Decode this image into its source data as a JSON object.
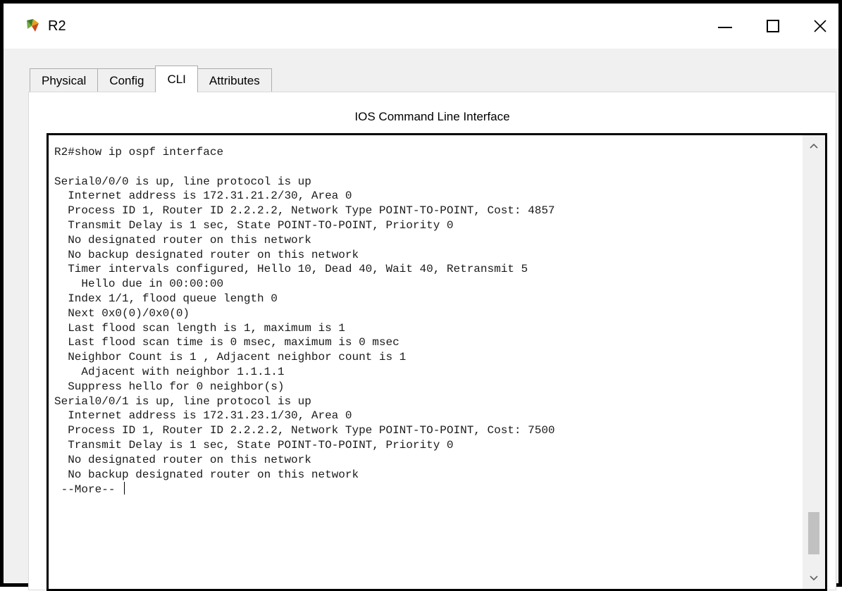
{
  "window": {
    "title": "R2",
    "icon": "router-device-icon"
  },
  "tabs": [
    {
      "label": "Physical",
      "active": false
    },
    {
      "label": "Config",
      "active": false
    },
    {
      "label": "CLI",
      "active": true
    },
    {
      "label": "Attributes",
      "active": false
    }
  ],
  "panel": {
    "title": "IOS Command Line Interface"
  },
  "cli": {
    "lines": [
      "R2#show ip ospf interface",
      "",
      "Serial0/0/0 is up, line protocol is up",
      "  Internet address is 172.31.21.2/30, Area 0",
      "  Process ID 1, Router ID 2.2.2.2, Network Type POINT-TO-POINT, Cost: 4857",
      "  Transmit Delay is 1 sec, State POINT-TO-POINT, Priority 0",
      "  No designated router on this network",
      "  No backup designated router on this network",
      "  Timer intervals configured, Hello 10, Dead 40, Wait 40, Retransmit 5",
      "    Hello due in 00:00:00",
      "  Index 1/1, flood queue length 0",
      "  Next 0x0(0)/0x0(0)",
      "  Last flood scan length is 1, maximum is 1",
      "  Last flood scan time is 0 msec, maximum is 0 msec",
      "  Neighbor Count is 1 , Adjacent neighbor count is 1",
      "    Adjacent with neighbor 1.1.1.1",
      "  Suppress hello for 0 neighbor(s)",
      "Serial0/0/1 is up, line protocol is up",
      "  Internet address is 172.31.23.1/30, Area 0",
      "  Process ID 1, Router ID 2.2.2.2, Network Type POINT-TO-POINT, Cost: 7500",
      "  Transmit Delay is 1 sec, State POINT-TO-POINT, Priority 0",
      "  No designated router on this network",
      "  No backup designated router on this network"
    ],
    "prompt": " --More-- "
  },
  "colors": {
    "window_border": "#000000",
    "tab_background": "#f0f0f0",
    "panel_background": "#ffffff",
    "scroll_thumb": "#c1c1c1"
  }
}
